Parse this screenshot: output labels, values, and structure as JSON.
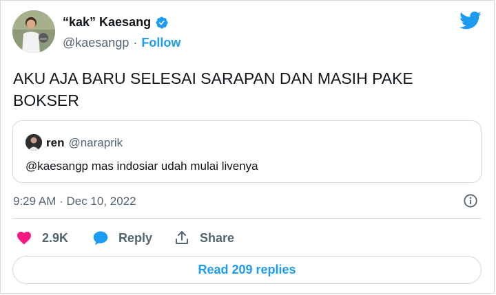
{
  "author": {
    "name": "“kak” Kaesang",
    "handle": "@kaesangp",
    "separator": "·",
    "follow_label": "Follow",
    "verified_icon": "verified-badge-icon"
  },
  "brand_icon": "twitter-bird-icon",
  "tweet": {
    "text": "AKU AJA BARU SELESAI SARAPAN DAN MASIH PAKE BOKSER"
  },
  "quoted_tweet": {
    "name": "ren",
    "handle": "@naraprik",
    "text": "@kaesangp mas indosiar udah mulai livenya"
  },
  "meta": {
    "timestamp": "9:29 AM · Dec 10, 2022",
    "info_icon": "info-icon"
  },
  "actions": {
    "like_count": "2.9K",
    "reply_label": "Reply",
    "share_label": "Share"
  },
  "read_replies_label": "Read 209 replies",
  "colors": {
    "accent": "#1d9bf0",
    "like": "#f91880",
    "text": "#0f1419",
    "secondary": "#536471",
    "border": "#cfd9de"
  }
}
